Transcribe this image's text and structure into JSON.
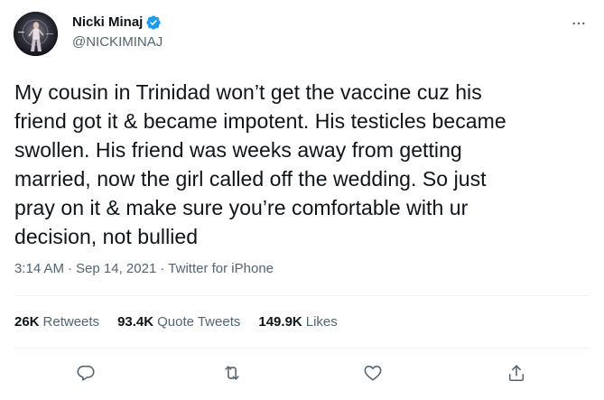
{
  "author": {
    "name": "Nicki Minaj",
    "handle": "@NICKIMINAJ",
    "verified": true
  },
  "tweet": {
    "text": "My cousin in Trinidad won’t get the vaccine cuz his\nfriend got it & became impotent. His testicles became\nswollen. His friend was weeks away from getting\nmarried, now the girl called off the wedding. So just\npray on it & make sure you’re comfortable with ur\ndecision, not bullied",
    "time": "3:14 AM",
    "date": "Sep 14, 2021",
    "source": "Twitter for iPhone",
    "separator": "·"
  },
  "stats": {
    "retweets": {
      "count": "26K",
      "label": "Retweets"
    },
    "quotes": {
      "count": "93.4K",
      "label": "Quote Tweets"
    },
    "likes": {
      "count": "149.9K",
      "label": "Likes"
    }
  },
  "icons": {
    "more": "more-horizontal-icon",
    "reply": "reply-icon",
    "retweet": "retweet-icon",
    "like": "heart-icon",
    "share": "share-icon",
    "verified": "verified-badge-icon"
  },
  "colors": {
    "text": "#0f1419",
    "secondary": "#536471",
    "verified": "#1d9bf0",
    "divider": "#eff3f4"
  }
}
